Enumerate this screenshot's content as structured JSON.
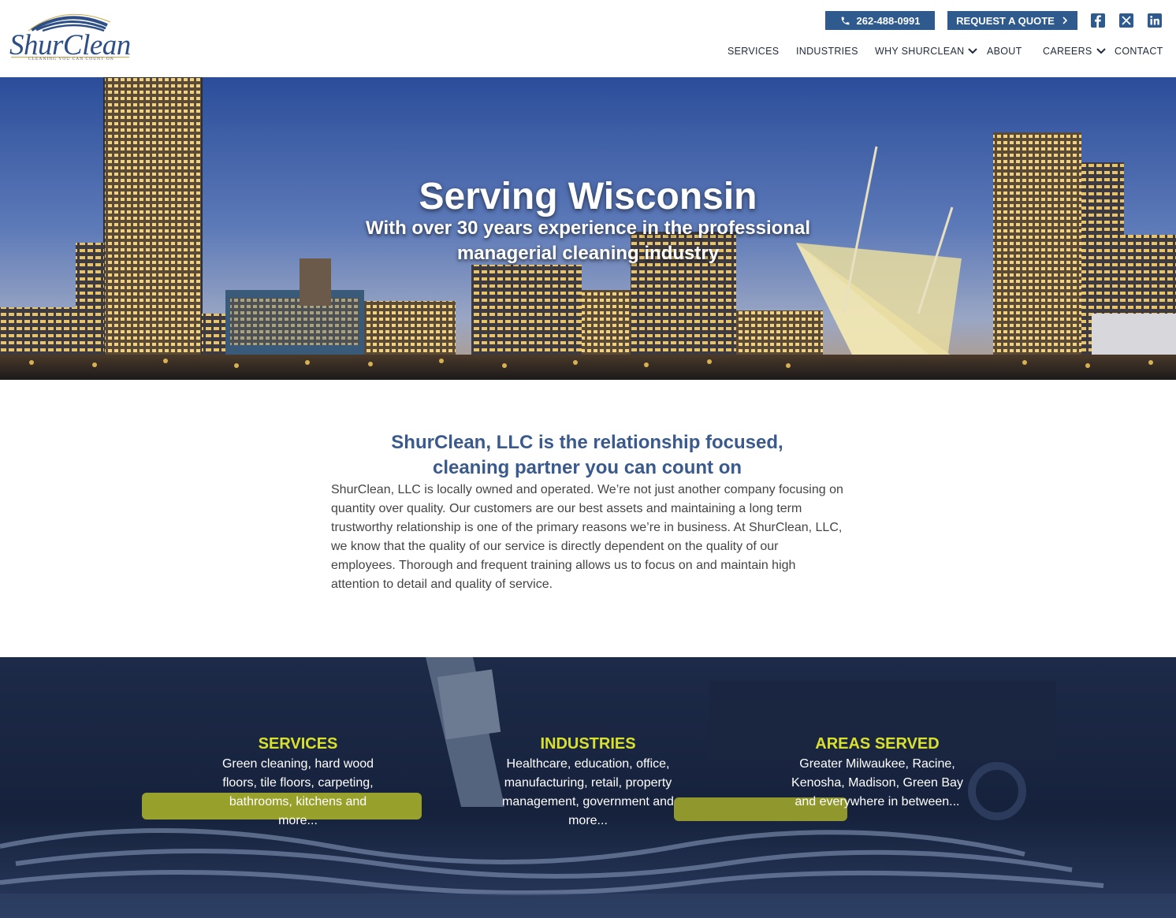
{
  "brand": {
    "name": "ShurClean",
    "tagline": "CLEANING YOU CAN COUNT ON"
  },
  "header": {
    "phone": "262-488-0991",
    "quote": "REQUEST A QUOTE"
  },
  "nav": [
    {
      "label": "SERVICES"
    },
    {
      "label": "INDUSTRIES"
    },
    {
      "label": "WHY SHURCLEAN"
    },
    {
      "label": "ABOUT"
    },
    {
      "label": "CAREERS"
    },
    {
      "label": "CONTACT"
    }
  ],
  "hero": {
    "title": "Serving Wisconsin",
    "subtitle": "With over 30 years experience in the professional managerial cleaning industry"
  },
  "intro": {
    "heading_line1": "ShurClean, LLC is the relationship focused,",
    "heading_line2": "cleaning partner you can count on",
    "body": "ShurClean, LLC is locally owned and operated. We’re not just another company focusing on quantity over quality. Our customers are our best assets and maintaining a long term trustworthy relationship is one of the primary reasons we’re in business. At ShurClean, LLC, we know that the quality of our service is directly dependent on the quality of our employees. Thorough and frequent training allows us to focus on and maintain high attention to detail and quality of service."
  },
  "features": [
    {
      "title": "SERVICES",
      "text": "Green cleaning, hard wood floors, tile floors, carpeting, bathrooms, kitchens and more..."
    },
    {
      "title": "INDUSTRIES",
      "text": "Healthcare, education, office, manufacturing, retail, property management, government and more..."
    },
    {
      "title": "AREAS SERVED",
      "text": "Greater Milwaukee, Racine, Kenosha, Madison, Green Bay and everywhere in between..."
    }
  ],
  "colors": {
    "primary": "#2e5a8e",
    "heading": "#3a5a8e",
    "accent": "#d9e12b"
  }
}
